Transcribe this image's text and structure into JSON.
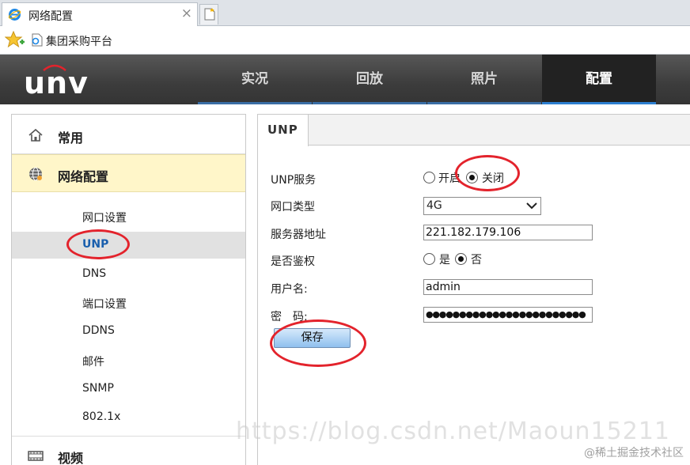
{
  "browser": {
    "tab_title": "网络配置",
    "tab_close": "×",
    "favorite_label": "集团采购平台"
  },
  "app": {
    "logo_text": "unv",
    "nav": [
      {
        "label": "实况"
      },
      {
        "label": "回放"
      },
      {
        "label": "照片"
      },
      {
        "label": "配置",
        "active": true
      }
    ]
  },
  "sidebar": {
    "home_label": "常用",
    "network_label": "网络配置",
    "items": [
      {
        "label": "网口设置"
      },
      {
        "label": "UNP",
        "selected": true
      },
      {
        "label": "DNS"
      },
      {
        "label": "端口设置"
      },
      {
        "label": "DDNS"
      },
      {
        "label": "邮件"
      },
      {
        "label": "SNMP"
      },
      {
        "label": "802.1x"
      }
    ],
    "video_label": "视频"
  },
  "main": {
    "tab_label": "UNP",
    "unp_service": {
      "label": "UNP服务",
      "on_label": "开启",
      "off_label": "关闭",
      "selected": "off"
    },
    "port_type": {
      "label": "网口类型",
      "value": "4G"
    },
    "server_address": {
      "label": "服务器地址",
      "value": "221.182.179.106"
    },
    "auth": {
      "label": "是否鉴权",
      "yes_label": "是",
      "no_label": "否",
      "selected": "no"
    },
    "username": {
      "label": "用户名:",
      "value": "admin"
    },
    "password": {
      "label": "密　码:",
      "value": "●●●●●●●●●●●●●●●●●●●●●●●●"
    },
    "save_label": "保存"
  },
  "watermarks": {
    "url": "https://blog.csdn.net/Maoun15211",
    "site": "@稀土掘金技术社区"
  },
  "colors": {
    "header_bg": "#3c3c3c",
    "nav_active_bg": "#222222",
    "accent_blue": "#2d7fd0",
    "sidebar_section_bg": "#fff6c9",
    "annotation_red": "#e3232c"
  }
}
